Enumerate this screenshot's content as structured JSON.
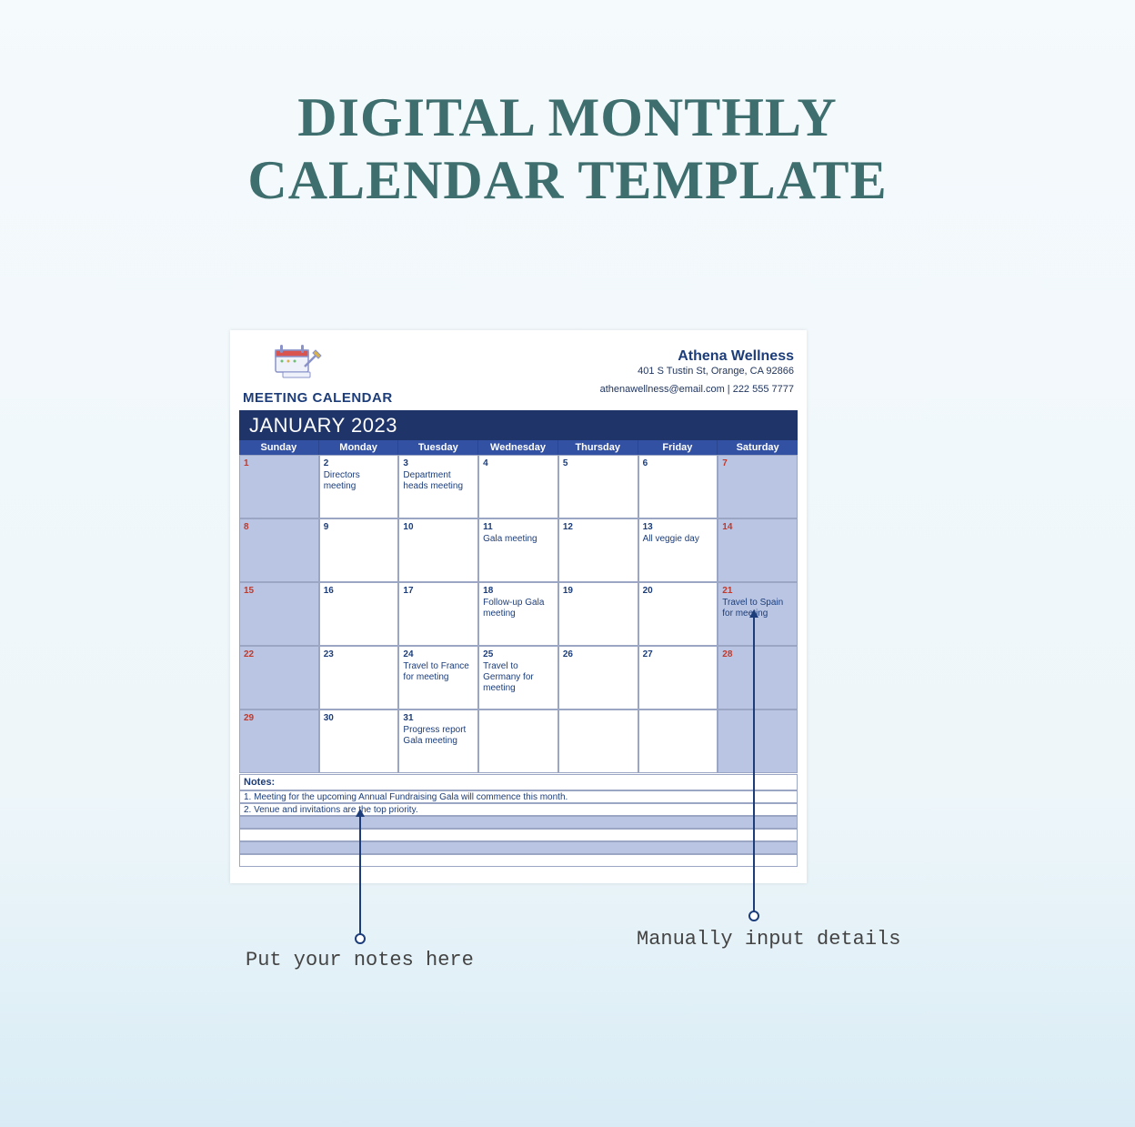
{
  "title_line1": "DIGITAL MONTHLY",
  "title_line2": "CALENDAR TEMPLATE",
  "header": {
    "logo_label": "MEETING CALENDAR",
    "company_name": "Athena Wellness",
    "company_address": "401 S Tustin St, Orange, CA 92866",
    "company_contact": "athenawellness@email.com | 222 555 7777"
  },
  "month_label": "JANUARY 2023",
  "day_headers": [
    "Sunday",
    "Monday",
    "Tuesday",
    "Wednesday",
    "Thursday",
    "Friday",
    "Saturday"
  ],
  "weeks": [
    [
      {
        "num": "1",
        "red": true,
        "weekend": true,
        "event": ""
      },
      {
        "num": "2",
        "red": false,
        "weekend": false,
        "event": "Directors meeting"
      },
      {
        "num": "3",
        "red": false,
        "weekend": false,
        "event": "Department heads meeting"
      },
      {
        "num": "4",
        "red": false,
        "weekend": false,
        "event": ""
      },
      {
        "num": "5",
        "red": false,
        "weekend": false,
        "event": ""
      },
      {
        "num": "6",
        "red": false,
        "weekend": false,
        "event": ""
      },
      {
        "num": "7",
        "red": true,
        "weekend": true,
        "event": ""
      }
    ],
    [
      {
        "num": "8",
        "red": true,
        "weekend": true,
        "event": ""
      },
      {
        "num": "9",
        "red": false,
        "weekend": false,
        "event": ""
      },
      {
        "num": "10",
        "red": false,
        "weekend": false,
        "event": ""
      },
      {
        "num": "11",
        "red": false,
        "weekend": false,
        "event": "Gala meeting"
      },
      {
        "num": "12",
        "red": false,
        "weekend": false,
        "event": ""
      },
      {
        "num": "13",
        "red": false,
        "weekend": false,
        "event": "All veggie day"
      },
      {
        "num": "14",
        "red": true,
        "weekend": true,
        "event": ""
      }
    ],
    [
      {
        "num": "15",
        "red": true,
        "weekend": true,
        "event": ""
      },
      {
        "num": "16",
        "red": false,
        "weekend": false,
        "event": ""
      },
      {
        "num": "17",
        "red": false,
        "weekend": false,
        "event": ""
      },
      {
        "num": "18",
        "red": false,
        "weekend": false,
        "event": "Follow-up Gala meeting"
      },
      {
        "num": "19",
        "red": false,
        "weekend": false,
        "event": ""
      },
      {
        "num": "20",
        "red": false,
        "weekend": false,
        "event": ""
      },
      {
        "num": "21",
        "red": true,
        "weekend": true,
        "event": "Travel to Spain for meeting"
      }
    ],
    [
      {
        "num": "22",
        "red": true,
        "weekend": true,
        "event": ""
      },
      {
        "num": "23",
        "red": false,
        "weekend": false,
        "event": ""
      },
      {
        "num": "24",
        "red": false,
        "weekend": false,
        "event": "Travel to France for meeting"
      },
      {
        "num": "25",
        "red": false,
        "weekend": false,
        "event": "Travel to Germany for meeting"
      },
      {
        "num": "26",
        "red": false,
        "weekend": false,
        "event": ""
      },
      {
        "num": "27",
        "red": false,
        "weekend": false,
        "event": ""
      },
      {
        "num": "28",
        "red": true,
        "weekend": true,
        "event": ""
      }
    ],
    [
      {
        "num": "29",
        "red": true,
        "weekend": true,
        "event": ""
      },
      {
        "num": "30",
        "red": false,
        "weekend": false,
        "event": ""
      },
      {
        "num": "31",
        "red": false,
        "weekend": false,
        "event": "Progress report Gala meeting"
      },
      {
        "num": "",
        "red": false,
        "weekend": false,
        "event": ""
      },
      {
        "num": "",
        "red": false,
        "weekend": false,
        "event": ""
      },
      {
        "num": "",
        "red": false,
        "weekend": false,
        "event": ""
      },
      {
        "num": "",
        "red": false,
        "weekend": true,
        "event": ""
      }
    ]
  ],
  "notes": {
    "title": "Notes:",
    "lines": [
      "1. Meeting for the upcoming Annual Fundraising Gala will commence this month.",
      "2. Venue and invitations are the top priority.",
      "",
      "",
      "",
      ""
    ]
  },
  "callouts": {
    "left": "Put your notes here",
    "right": "Manually input details"
  }
}
